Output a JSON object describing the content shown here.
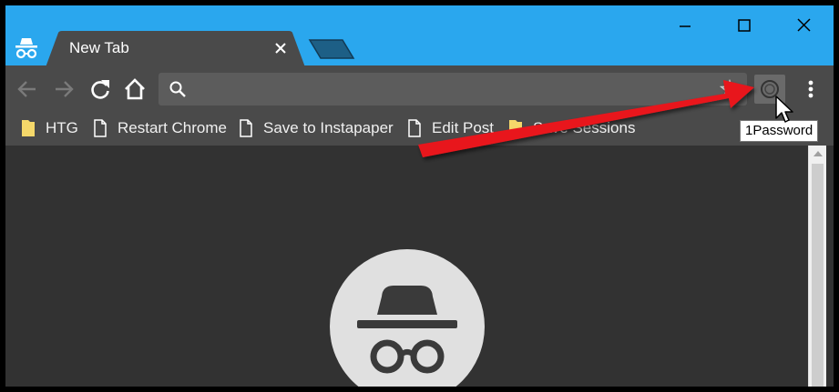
{
  "window": {
    "tab_title": "New Tab",
    "titlebar_color": "#2aa7ee",
    "controls": [
      "minimize",
      "maximize",
      "close"
    ]
  },
  "toolbar": {
    "buttons": [
      "back-icon",
      "forward-icon",
      "reload-icon",
      "home-icon"
    ],
    "omnibox_value": "",
    "extension_tooltip": "1Password"
  },
  "bookmarks": [
    {
      "label": "HTG",
      "icon": "folder-icon"
    },
    {
      "label": "Restart Chrome",
      "icon": "page-icon"
    },
    {
      "label": "Save to Instapaper",
      "icon": "page-icon"
    },
    {
      "label": "Edit Post",
      "icon": "page-icon"
    },
    {
      "label": "Save Sessions",
      "icon": "folder-icon"
    }
  ],
  "annotation": {
    "arrow_color": "#e8141b"
  }
}
